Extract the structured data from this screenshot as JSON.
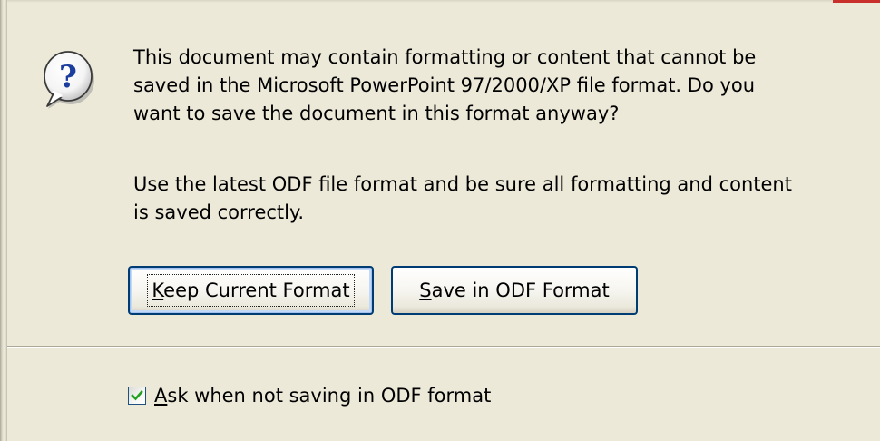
{
  "dialog": {
    "message_line1": "This document may contain formatting or content that cannot be",
    "message_line2": "saved in the Microsoft PowerPoint 97/2000/XP file format. Do you",
    "message_line3": "want to save the document in this format anyway?",
    "odf_line1": "Use the latest ODF file format and be sure all formatting and content",
    "odf_line2": "is saved correctly.",
    "icon": "question-icon"
  },
  "buttons": {
    "keep_access_key": "K",
    "keep_rest": "eep Current Format",
    "save_access_key": "S",
    "save_rest": "ave in ODF Format"
  },
  "checkbox": {
    "checked": true,
    "label_access_key": "A",
    "label_rest": "sk when not saving in ODF format"
  },
  "colors": {
    "dialog_background": "#ece9d8",
    "button_border": "#003c74",
    "checkmark": "#21a121",
    "icon_question": "#1b3d9e"
  }
}
